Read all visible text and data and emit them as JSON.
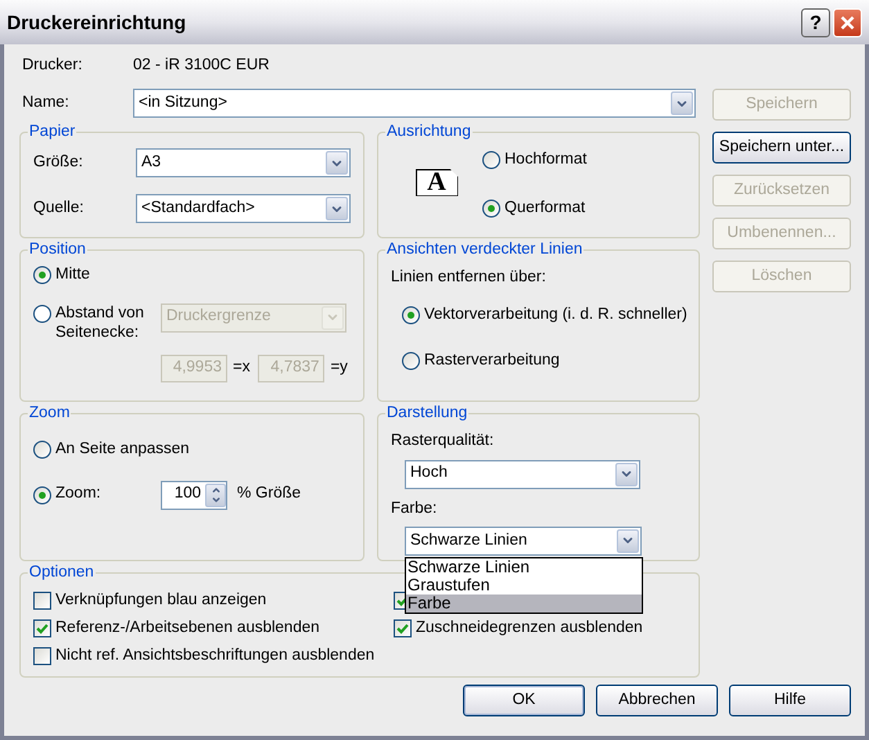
{
  "window": {
    "title": "Druckereinrichtung",
    "help_button": "?"
  },
  "printer": {
    "label": "Drucker:",
    "value": "02 - iR 3100C EUR"
  },
  "name": {
    "label": "Name:",
    "value": "<in Sitzung>"
  },
  "paper": {
    "title": "Papier",
    "fields": [
      {
        "label": "Größe:",
        "value": "A3"
      },
      {
        "label": "Quelle:",
        "value": "<Standardfach>"
      }
    ]
  },
  "orientation": {
    "title": "Ausrichtung",
    "preview": "A",
    "options": [
      {
        "label": "Hochformat",
        "selected": false
      },
      {
        "label": "Querformat",
        "selected": true
      }
    ]
  },
  "position": {
    "title": "Position",
    "options": [
      {
        "label": "Mitte",
        "selected": true
      },
      {
        "label": "Abstand von Seitenecke:",
        "selected": false
      }
    ],
    "corner": {
      "value": "Druckergrenze",
      "disabled": true
    },
    "coords": [
      {
        "value": "4,9953",
        "suffix": "=x",
        "disabled": true
      },
      {
        "value": "4,7837",
        "suffix": "=y",
        "disabled": true
      }
    ]
  },
  "hidden_lines": {
    "title": "Ansichten verdeckter Linien",
    "label": "Linien entfernen über:",
    "options": [
      {
        "label": "Vektorverarbeitung (i. d. R. schneller)",
        "selected": true
      },
      {
        "label": "Rasterverarbeitung",
        "selected": false
      }
    ]
  },
  "zoom": {
    "title": "Zoom",
    "options": [
      {
        "label": "An Seite anpassen",
        "selected": false
      },
      {
        "label": "Zoom:",
        "selected": true
      }
    ],
    "value": "100",
    "unit": "% Größe"
  },
  "display": {
    "title": "Darstellung",
    "raster_label": "Rasterqualität:",
    "raster_value": "Hoch",
    "color_label": "Farbe:",
    "color_value": "Schwarze Linien",
    "dropdown": [
      {
        "label": "Schwarze Linien",
        "selected": false
      },
      {
        "label": "Graustufen",
        "selected": false
      },
      {
        "label": "Farbe",
        "selected": true
      }
    ]
  },
  "options": {
    "title": "Optionen",
    "left": [
      {
        "label": "Verknüpfungen blau anzeigen",
        "checked": false
      },
      {
        "label": "Referenz-/Arbeitsebenen ausblenden",
        "checked": true
      },
      {
        "label": "Nicht ref. Ansichtsbeschriftungen ausblenden",
        "checked": false
      }
    ],
    "right": [
      {
        "checked": true
      },
      {
        "label": "Zuschneidegrenzen ausblenden",
        "checked": true
      }
    ]
  },
  "side_buttons": [
    {
      "label": "Speichern",
      "disabled": true
    },
    {
      "label": "Speichern unter...",
      "disabled": false
    },
    {
      "label": "Zurücksetzen",
      "disabled": true
    },
    {
      "label": "Umbenennen...",
      "disabled": true
    },
    {
      "label": "Löschen",
      "disabled": true
    }
  ],
  "buttons": [
    "OK",
    "Abbrechen",
    "Hilfe"
  ]
}
